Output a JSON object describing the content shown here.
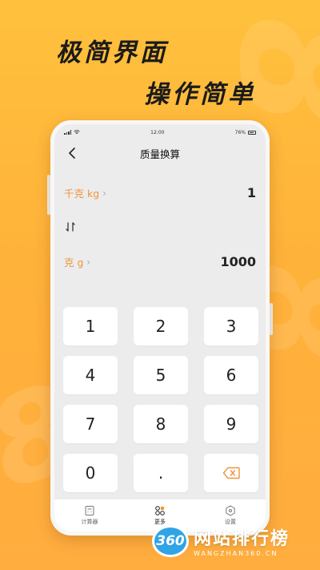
{
  "promo": {
    "headline_1": "极简界面",
    "headline_2": "操作简单"
  },
  "status_bar": {
    "time": "12:00",
    "battery": "76%"
  },
  "nav": {
    "title": "质量换算",
    "back_icon": "chevron-left-icon"
  },
  "converter": {
    "from_unit": "千克 kg",
    "from_value": "1",
    "swap_icon": "swap-vertical-icon",
    "to_unit": "克 g",
    "to_value": "1000"
  },
  "keypad": {
    "keys": [
      "1",
      "2",
      "3",
      "4",
      "5",
      "6",
      "7",
      "8",
      "9",
      "0",
      ".",
      "⌫"
    ],
    "delete_icon": "backspace-icon"
  },
  "tabbar": {
    "tabs": [
      {
        "label": "计算器",
        "icon": "calculator-icon"
      },
      {
        "label": "更多",
        "icon": "grid-icon"
      },
      {
        "label": "设置",
        "icon": "settings-hexagon-icon"
      }
    ]
  },
  "watermark": {
    "logo": "360",
    "name": "网站排行榜",
    "url": "WANGZHAN360.CN"
  },
  "colors": {
    "background": "#ffb83c",
    "accent": "#f0953c",
    "text": "#222222"
  }
}
